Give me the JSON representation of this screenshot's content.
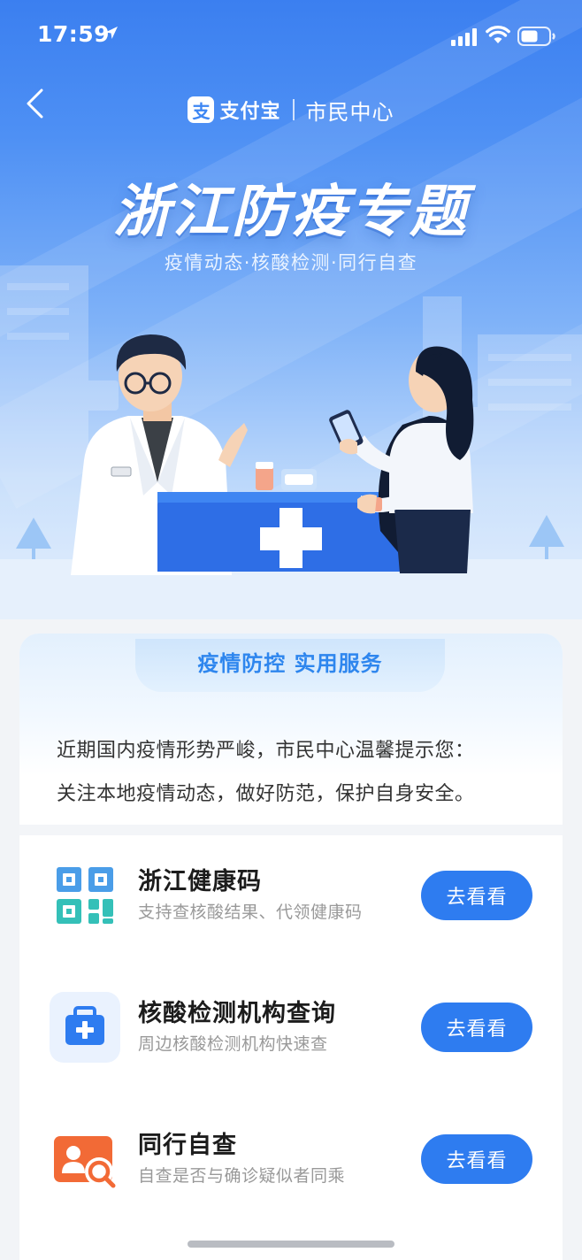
{
  "status_bar": {
    "time": "17:59"
  },
  "nav": {
    "brand_logo": "支",
    "brand_name": "支付宝",
    "sub_title": "市民中心"
  },
  "hero": {
    "title": "浙江防疫专题",
    "subtitle": "疫情动态·核酸检测·同行自查"
  },
  "section": {
    "header": "疫情防控 实用服务",
    "notice": [
      "近期国内疫情形势严峻，市民中心温馨提示您：",
      "关注本地疫情动态，做好防范，保护自身安全。"
    ]
  },
  "services": [
    {
      "title": "浙江健康码",
      "desc": "支持查核酸结果、代领健康码",
      "button": "去看看",
      "icon": "qr-code-icon"
    },
    {
      "title": "核酸检测机构查询",
      "desc": "周边核酸检测机构快速查",
      "button": "去看看",
      "icon": "medical-kit-icon"
    },
    {
      "title": "同行自查",
      "desc": "自查是否与确诊疑似者同乘",
      "button": "去看看",
      "icon": "person-search-icon"
    }
  ],
  "colors": {
    "primary": "#2e7cf0",
    "header_text": "#2e86ee",
    "hero_top": "#3b7ff0"
  }
}
